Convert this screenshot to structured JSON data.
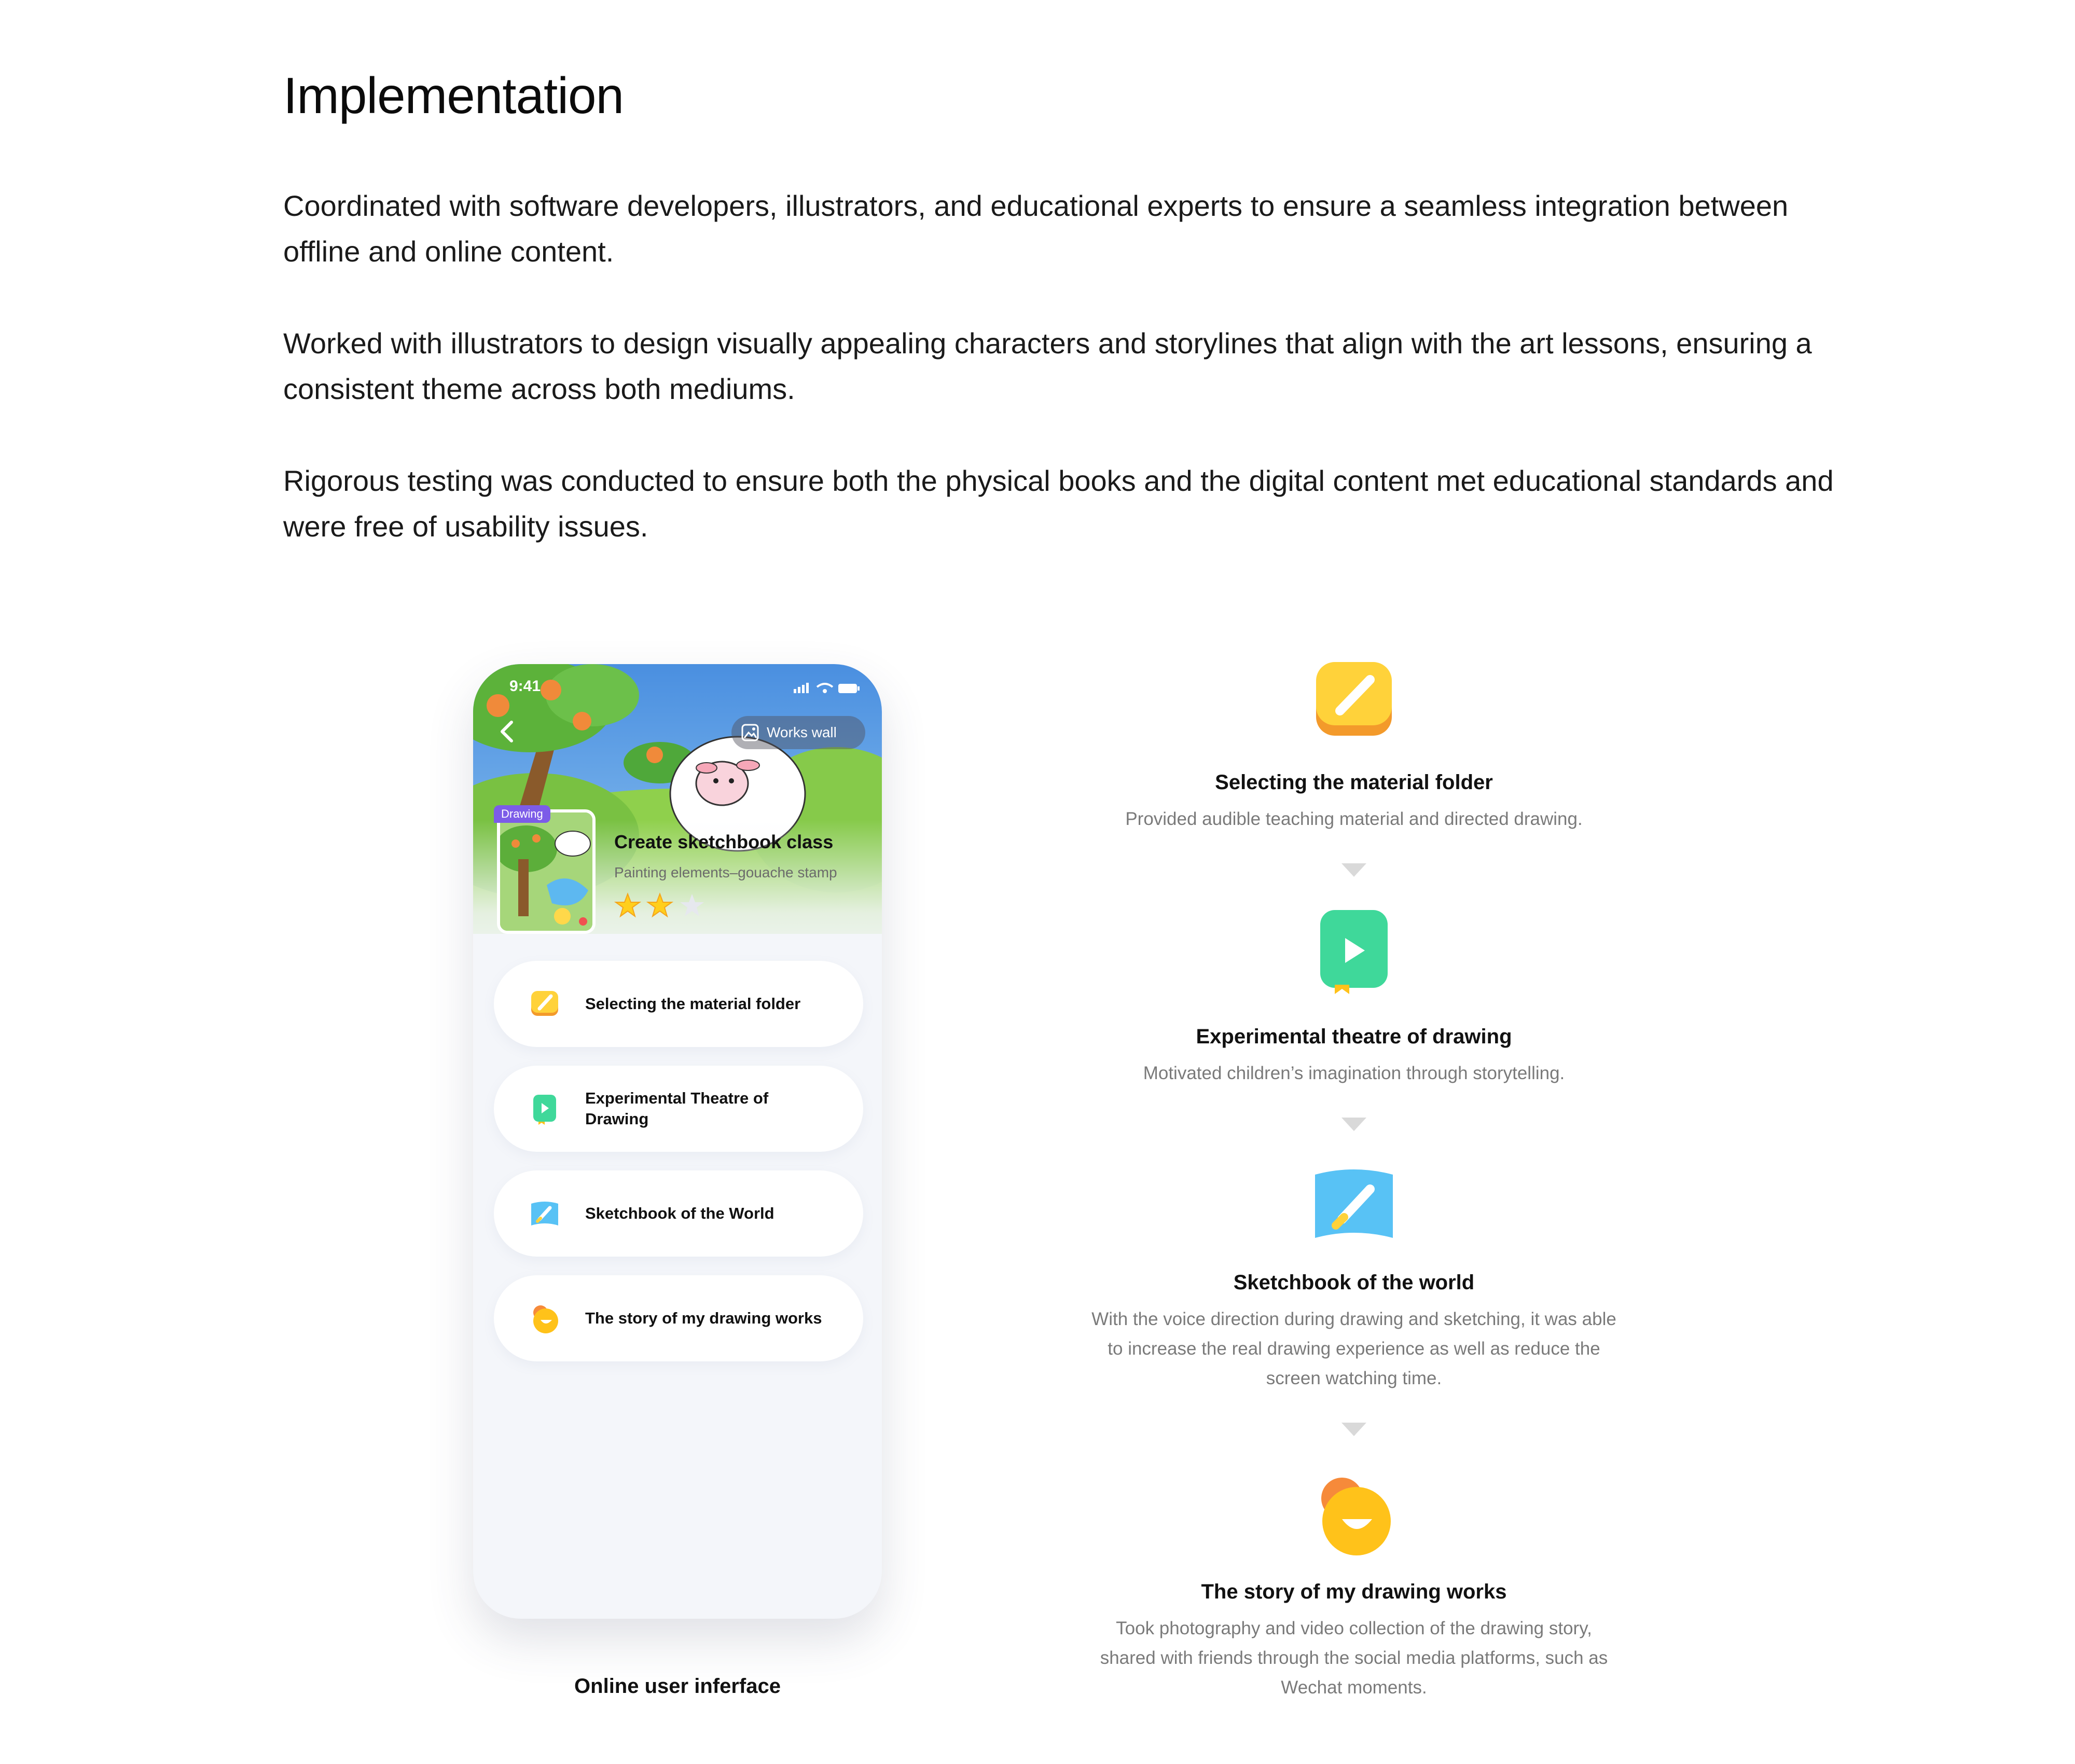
{
  "page": {
    "title": "Implementation",
    "paragraphs": [
      "Coordinated with software developers, illustrators, and educational experts to ensure a seamless integration between offline and online content.",
      "Worked with illustrators to design visually appealing characters and storylines that align with the art lessons, ensuring a consistent theme across both mediums.",
      "Rigorous testing was conducted to ensure both the physical books and the digital content met educational standards and were free of usability issues."
    ]
  },
  "phone": {
    "status_time": "9:41",
    "works_wall_label": "Works wall",
    "thumb_tag": "Drawing",
    "class_title": "Create sketchbook class",
    "class_subtitle": "Painting elements–gouache stamp",
    "rating": 2,
    "rating_max": 3,
    "menu": [
      {
        "label": "Selecting the material folder",
        "icon": "brush-folder-icon",
        "color": "#f7c028"
      },
      {
        "label": "Experimental Theatre of Drawing",
        "icon": "play-theatre-icon",
        "color": "#3fd89a"
      },
      {
        "label": "Sketchbook of the World",
        "icon": "sketchbook-icon",
        "color": "#58c2f5"
      },
      {
        "label": "The story of my drawing works",
        "icon": "smile-story-icon",
        "color": "#ffc21a"
      }
    ]
  },
  "ui_caption": "Online user inferface",
  "flow": [
    {
      "heading": "Selecting the material folder",
      "desc": "Provided audible teaching material and directed drawing.",
      "icon": "brush-folder-icon"
    },
    {
      "heading": "Experimental theatre of drawing",
      "desc": "Motivated children’s imagination through storytelling.",
      "icon": "play-theatre-icon"
    },
    {
      "heading": "Sketchbook of the world",
      "desc": "With the voice direction during drawing and sketching, it was able to increase the real drawing experience as well as reduce the screen watching time.",
      "icon": "sketchbook-icon"
    },
    {
      "heading": "The story of my drawing works",
      "desc": "Took photography and video collection of the drawing story, shared with friends through the social media platforms, such as Wechat moments.",
      "icon": "smile-story-icon"
    }
  ],
  "colors": {
    "text": "#111111",
    "muted": "#7a7a7a",
    "phone_bg": "#f4f6fa",
    "tag_purple": "#7c5ce8",
    "star": "#ffcf1c"
  }
}
